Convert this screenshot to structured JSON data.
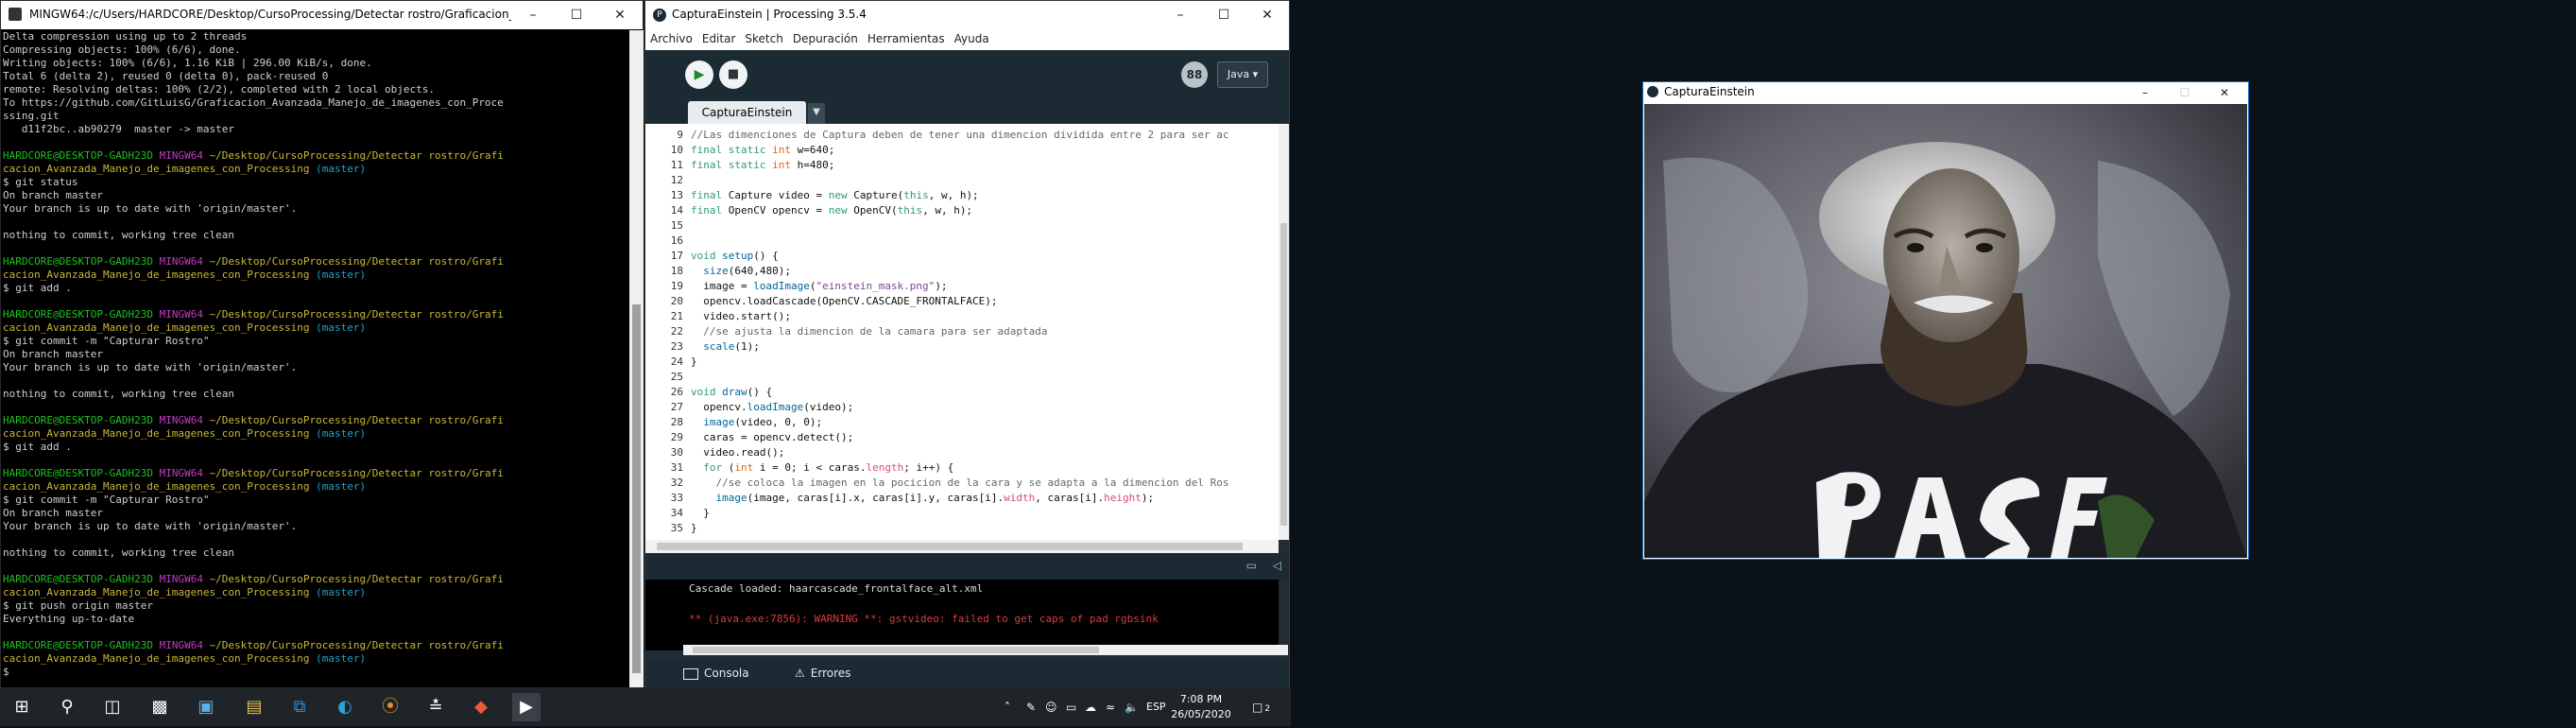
{
  "terminal": {
    "title": "MINGW64:/c/Users/HARDCORE/Desktop/CursoProcessing/Detectar rostro/Graficacion_Avanza...",
    "lines": [
      [
        {
          "t": "Delta compression using up to 2 threads"
        }
      ],
      [
        {
          "t": "Compressing objects: 100% (6/6), done."
        }
      ],
      [
        {
          "t": "Writing objects: 100% (6/6), 1.16 KiB | 296.00 KiB/s, done."
        }
      ],
      [
        {
          "t": "Total 6 (delta 2), reused 0 (delta 0), pack-reused 0"
        }
      ],
      [
        {
          "t": "remote: Resolving deltas: 100% (2/2), completed with 2 local objects."
        }
      ],
      [
        {
          "t": "To https://github.com/GitLuisG/Graficacion_Avanzada_Manejo_de_imagenes_con_Proce"
        }
      ],
      [
        {
          "t": "ssing.git"
        }
      ],
      [
        {
          "t": "   d11f2bc..ab90279  master -> master"
        }
      ],
      [
        {
          "t": ""
        }
      ],
      [
        {
          "t": "HARDCORE@DESKTOP-GADH23D ",
          "c": "t-green"
        },
        {
          "t": "MINGW64 ",
          "c": "t-mag"
        },
        {
          "t": "~/Desktop/CursoProcessing/Detectar rostro/Grafi",
          "c": "t-yel"
        }
      ],
      [
        {
          "t": "cacion_Avanzada_Manejo_de_imagenes_con_Processing ",
          "c": "t-yel"
        },
        {
          "t": "(master)",
          "c": "t-cyan"
        }
      ],
      [
        {
          "t": "$ git status"
        }
      ],
      [
        {
          "t": "On branch master"
        }
      ],
      [
        {
          "t": "Your branch is up to date with 'origin/master'."
        }
      ],
      [
        {
          "t": ""
        }
      ],
      [
        {
          "t": "nothing to commit, working tree clean"
        }
      ],
      [
        {
          "t": ""
        }
      ],
      [
        {
          "t": "HARDCORE@DESKTOP-GADH23D ",
          "c": "t-green"
        },
        {
          "t": "MINGW64 ",
          "c": "t-mag"
        },
        {
          "t": "~/Desktop/CursoProcessing/Detectar rostro/Grafi",
          "c": "t-yel"
        }
      ],
      [
        {
          "t": "cacion_Avanzada_Manejo_de_imagenes_con_Processing ",
          "c": "t-yel"
        },
        {
          "t": "(master)",
          "c": "t-cyan"
        }
      ],
      [
        {
          "t": "$ git add ."
        }
      ],
      [
        {
          "t": ""
        }
      ],
      [
        {
          "t": "HARDCORE@DESKTOP-GADH23D ",
          "c": "t-green"
        },
        {
          "t": "MINGW64 ",
          "c": "t-mag"
        },
        {
          "t": "~/Desktop/CursoProcessing/Detectar rostro/Grafi",
          "c": "t-yel"
        }
      ],
      [
        {
          "t": "cacion_Avanzada_Manejo_de_imagenes_con_Processing ",
          "c": "t-yel"
        },
        {
          "t": "(master)",
          "c": "t-cyan"
        }
      ],
      [
        {
          "t": "$ git commit -m \"Capturar Rostro\""
        }
      ],
      [
        {
          "t": "On branch master"
        }
      ],
      [
        {
          "t": "Your branch is up to date with 'origin/master'."
        }
      ],
      [
        {
          "t": ""
        }
      ],
      [
        {
          "t": "nothing to commit, working tree clean"
        }
      ],
      [
        {
          "t": ""
        }
      ],
      [
        {
          "t": "HARDCORE@DESKTOP-GADH23D ",
          "c": "t-green"
        },
        {
          "t": "MINGW64 ",
          "c": "t-mag"
        },
        {
          "t": "~/Desktop/CursoProcessing/Detectar rostro/Grafi",
          "c": "t-yel"
        }
      ],
      [
        {
          "t": "cacion_Avanzada_Manejo_de_imagenes_con_Processing ",
          "c": "t-yel"
        },
        {
          "t": "(master)",
          "c": "t-cyan"
        }
      ],
      [
        {
          "t": "$ git add ."
        }
      ],
      [
        {
          "t": ""
        }
      ],
      [
        {
          "t": "HARDCORE@DESKTOP-GADH23D ",
          "c": "t-green"
        },
        {
          "t": "MINGW64 ",
          "c": "t-mag"
        },
        {
          "t": "~/Desktop/CursoProcessing/Detectar rostro/Grafi",
          "c": "t-yel"
        }
      ],
      [
        {
          "t": "cacion_Avanzada_Manejo_de_imagenes_con_Processing ",
          "c": "t-yel"
        },
        {
          "t": "(master)",
          "c": "t-cyan"
        }
      ],
      [
        {
          "t": "$ git commit -m \"Capturar Rostro\""
        }
      ],
      [
        {
          "t": "On branch master"
        }
      ],
      [
        {
          "t": "Your branch is up to date with 'origin/master'."
        }
      ],
      [
        {
          "t": ""
        }
      ],
      [
        {
          "t": "nothing to commit, working tree clean"
        }
      ],
      [
        {
          "t": ""
        }
      ],
      [
        {
          "t": "HARDCORE@DESKTOP-GADH23D ",
          "c": "t-green"
        },
        {
          "t": "MINGW64 ",
          "c": "t-mag"
        },
        {
          "t": "~/Desktop/CursoProcessing/Detectar rostro/Grafi",
          "c": "t-yel"
        }
      ],
      [
        {
          "t": "cacion_Avanzada_Manejo_de_imagenes_con_Processing ",
          "c": "t-yel"
        },
        {
          "t": "(master)",
          "c": "t-cyan"
        }
      ],
      [
        {
          "t": "$ git push origin master"
        }
      ],
      [
        {
          "t": "Everything up-to-date"
        }
      ],
      [
        {
          "t": ""
        }
      ],
      [
        {
          "t": "HARDCORE@DESKTOP-GADH23D ",
          "c": "t-green"
        },
        {
          "t": "MINGW64 ",
          "c": "t-mag"
        },
        {
          "t": "~/Desktop/CursoProcessing/Detectar rostro/Grafi",
          "c": "t-yel"
        }
      ],
      [
        {
          "t": "cacion_Avanzada_Manejo_de_imagenes_con_Processing ",
          "c": "t-yel"
        },
        {
          "t": "(master)",
          "c": "t-cyan"
        }
      ],
      [
        {
          "t": "$"
        }
      ]
    ]
  },
  "ide": {
    "title": "CapturaEinstein | Processing 3.5.4",
    "menu": [
      "Archivo",
      "Editar",
      "Sketch",
      "Depuración",
      "Herramientas",
      "Ayuda"
    ],
    "mode": "Java ▾",
    "mode_icon": "88",
    "tab": "CapturaEinstein",
    "line_numbers": [
      "9",
      "10",
      "11",
      "12",
      "13",
      "14",
      "15",
      "16",
      "17",
      "18",
      "19",
      "20",
      "21",
      "22",
      "23",
      "24",
      "25",
      "26",
      "27",
      "28",
      "29",
      "30",
      "31",
      "32",
      "33",
      "34",
      "35"
    ],
    "code": [
      [
        {
          "t": "//Las dimenciones de Captura deben de tener una dimencion dividida entre 2 para ser ac",
          "c": "k-cm"
        }
      ],
      [
        {
          "t": "final static ",
          "c": "k-kw"
        },
        {
          "t": "int",
          "c": "k-ty"
        },
        {
          "t": " w=640;"
        }
      ],
      [
        {
          "t": "final static ",
          "c": "k-kw"
        },
        {
          "t": "int",
          "c": "k-ty"
        },
        {
          "t": " h=480;"
        }
      ],
      [
        {
          "t": ""
        }
      ],
      [
        {
          "t": "final",
          "c": "k-kw"
        },
        {
          "t": " Capture video = "
        },
        {
          "t": "new",
          "c": "k-kw"
        },
        {
          "t": " Capture("
        },
        {
          "t": "this",
          "c": "k-kw"
        },
        {
          "t": ", w, h);"
        }
      ],
      [
        {
          "t": "final",
          "c": "k-kw"
        },
        {
          "t": " OpenCV opencv = "
        },
        {
          "t": "new",
          "c": "k-kw"
        },
        {
          "t": " OpenCV("
        },
        {
          "t": "this",
          "c": "k-kw"
        },
        {
          "t": ", w, h);"
        }
      ],
      [
        {
          "t": ""
        }
      ],
      [
        {
          "t": ""
        }
      ],
      [
        {
          "t": "void",
          "c": "k-kw"
        },
        {
          "t": " "
        },
        {
          "t": "setup",
          "c": "k-fn"
        },
        {
          "t": "() {"
        }
      ],
      [
        {
          "t": "  "
        },
        {
          "t": "size",
          "c": "k-fn"
        },
        {
          "t": "(640,480);"
        }
      ],
      [
        {
          "t": "  image = "
        },
        {
          "t": "loadImage",
          "c": "k-fn"
        },
        {
          "t": "("
        },
        {
          "t": "\"einstein_mask.png\"",
          "c": "k-str"
        },
        {
          "t": ");"
        }
      ],
      [
        {
          "t": "  opencv.loadCascade(OpenCV.CASCADE_FRONTALFACE);"
        }
      ],
      [
        {
          "t": "  video.start();"
        }
      ],
      [
        {
          "t": "  //se ajusta la dimencion de la camara para ser adaptada",
          "c": "k-cm"
        }
      ],
      [
        {
          "t": "  "
        },
        {
          "t": "scale",
          "c": "k-fn"
        },
        {
          "t": "(1);"
        }
      ],
      [
        {
          "t": "}"
        }
      ],
      [
        {
          "t": ""
        }
      ],
      [
        {
          "t": "void",
          "c": "k-kw"
        },
        {
          "t": " "
        },
        {
          "t": "draw",
          "c": "k-fn"
        },
        {
          "t": "() {"
        }
      ],
      [
        {
          "t": "  opencv."
        },
        {
          "t": "loadImage",
          "c": "k-fn"
        },
        {
          "t": "(video);"
        }
      ],
      [
        {
          "t": "  "
        },
        {
          "t": "image",
          "c": "k-fn"
        },
        {
          "t": "(video, 0, 0);"
        }
      ],
      [
        {
          "t": "  caras = opencv.detect();"
        }
      ],
      [
        {
          "t": "  video.read();"
        }
      ],
      [
        {
          "t": "  "
        },
        {
          "t": "for",
          "c": "k-kw"
        },
        {
          "t": " ("
        },
        {
          "t": "int",
          "c": "k-ty"
        },
        {
          "t": " i = 0; i < caras."
        },
        {
          "t": "length",
          "c": "k-fd"
        },
        {
          "t": "; i++) {"
        }
      ],
      [
        {
          "t": "    //se coloca la imagen en la pocicion de la cara y se adapta a la dimencion del Ros",
          "c": "k-cm"
        }
      ],
      [
        {
          "t": "    "
        },
        {
          "t": "image",
          "c": "k-fn"
        },
        {
          "t": "(image, caras[i].x, caras[i].y, caras[i]."
        },
        {
          "t": "width",
          "c": "k-fd"
        },
        {
          "t": ", caras[i]."
        },
        {
          "t": "height",
          "c": "k-fd"
        },
        {
          "t": ");"
        }
      ],
      [
        {
          "t": "  }"
        }
      ],
      [
        {
          "t": "}"
        }
      ]
    ],
    "console": {
      "line1": "Cascade loaded: haarcascade_frontalface_alt.xml",
      "line2": "** (java.exe:7856): WARNING **: gstvideo: failed to get caps of pad rgbsink"
    },
    "console_tab": "Consola",
    "errors_tab": "Errores"
  },
  "capture_window": {
    "title": "CapturaEinstein"
  },
  "taskbar": {
    "lang": "ESP",
    "time": "7:08 PM",
    "date": "26/05/2020",
    "notification_count": "2"
  }
}
